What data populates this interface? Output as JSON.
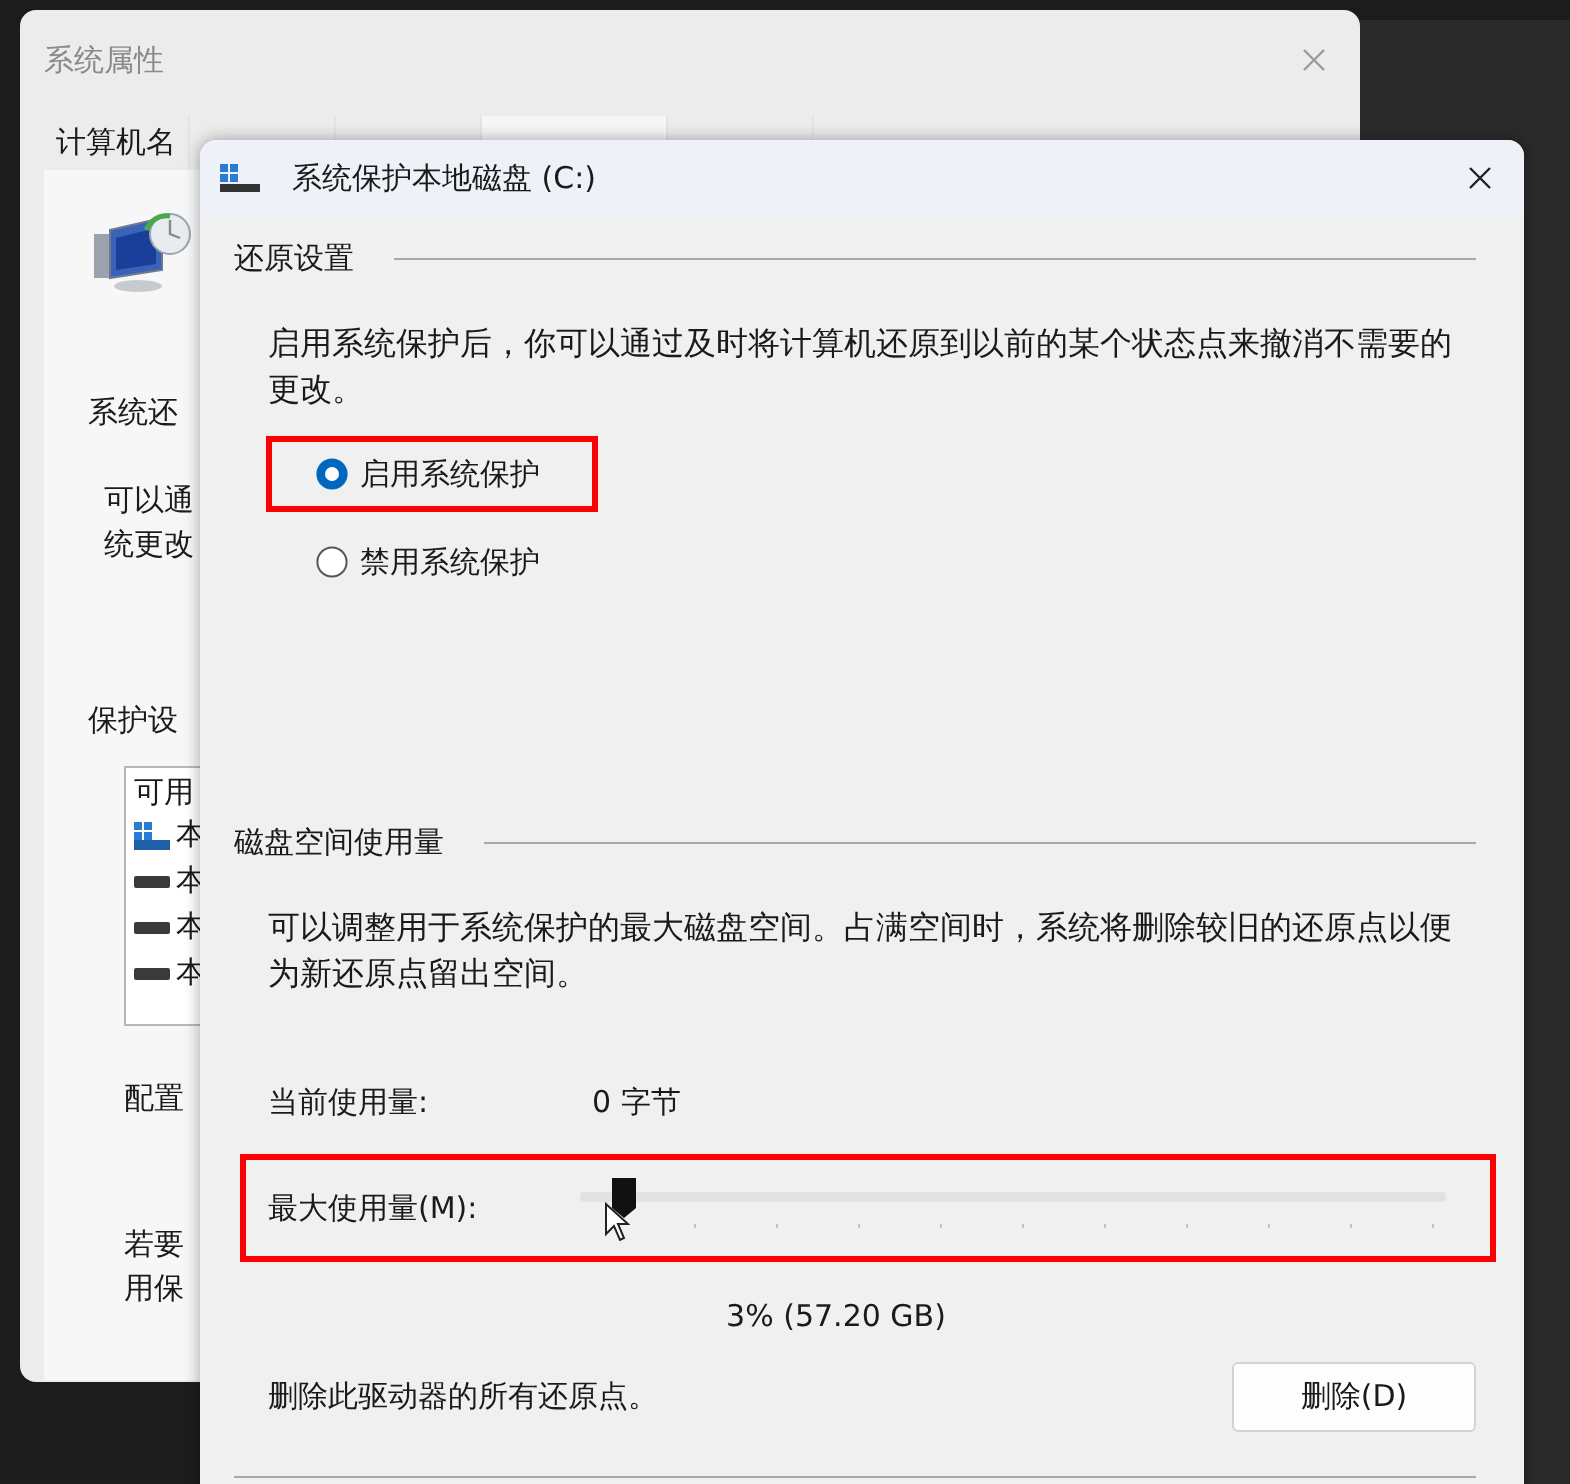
{
  "background_window": {
    "title": "系统属性",
    "tabs": [
      {
        "label": "计算机名",
        "selected": false
      },
      {
        "selected": false
      },
      {
        "selected": false
      },
      {
        "selected": true
      },
      {
        "selected": false
      }
    ],
    "restore_heading": "系统还",
    "restore_text": [
      "可以通",
      "统更改"
    ],
    "protection_heading": "保护设",
    "drive_list": {
      "header": "可用",
      "items": [
        {
          "kind": "system",
          "label": "本"
        },
        {
          "kind": "drive",
          "label": "本"
        },
        {
          "kind": "drive",
          "label": "本"
        },
        {
          "kind": "drive",
          "label": "本"
        }
      ]
    },
    "configure_text": "配置",
    "create_text": [
      "若要",
      "用保"
    ]
  },
  "dialog": {
    "title": "系统保护本地磁盘 (C:)",
    "restore_settings": {
      "heading": "还原设置",
      "description": "启用系统保护后，你可以通过及时将计算机还原到以前的某个状态点来撤消不需要的更改。",
      "options": [
        {
          "label": "启用系统保护",
          "selected": true,
          "highlighted": true
        },
        {
          "label": "禁用系统保护",
          "selected": false,
          "highlighted": false
        }
      ]
    },
    "disk_usage": {
      "heading": "磁盘空间使用量",
      "description": "可以调整用于系统保护的最大磁盘空间。占满空间时，系统将删除较旧的还原点以便为新还原点留出空间。",
      "current_label": "当前使用量:",
      "current_value": "0 字节",
      "max_label": "最大使用量(M):",
      "level": 0.03,
      "highlighted": true,
      "max_reading": "3% (57.20 GB)",
      "delete_text": "删除此驱动器的所有还原点。",
      "delete_button": "删除(D)"
    }
  }
}
